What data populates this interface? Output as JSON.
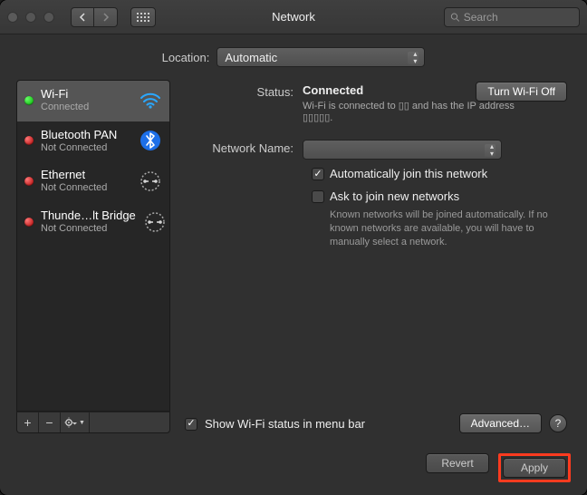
{
  "titlebar": {
    "title": "Network",
    "search_placeholder": "Search"
  },
  "location": {
    "label": "Location:",
    "value": "Automatic"
  },
  "services": [
    {
      "name": "Wi-Fi",
      "status": "Connected",
      "dot": "green",
      "icon": "wifi"
    },
    {
      "name": "Bluetooth PAN",
      "status": "Not Connected",
      "dot": "red",
      "icon": "bluetooth"
    },
    {
      "name": "Ethernet",
      "status": "Not Connected",
      "dot": "red",
      "icon": "ethernet"
    },
    {
      "name": "Thunde…lt Bridge",
      "status": "Not Connected",
      "dot": "red",
      "icon": "ethernet"
    }
  ],
  "detail": {
    "status_label": "Status:",
    "status_value": "Connected",
    "turn_off_label": "Turn Wi-Fi Off",
    "sub_status": "Wi-Fi is connected to ▯▯ and has the IP address ▯▯▯▯▯.",
    "network_name_label": "Network Name:",
    "network_name_value": "",
    "auto_join_label": "Automatically join this network",
    "auto_join_checked": true,
    "ask_join_label": "Ask to join new networks",
    "ask_join_checked": false,
    "ask_join_help": "Known networks will be joined automatically. If no known networks are available, you will have to manually select a network.",
    "show_menu_label": "Show Wi-Fi status in menu bar",
    "show_menu_checked": true,
    "advanced_label": "Advanced…"
  },
  "footer": {
    "revert": "Revert",
    "apply": "Apply"
  }
}
